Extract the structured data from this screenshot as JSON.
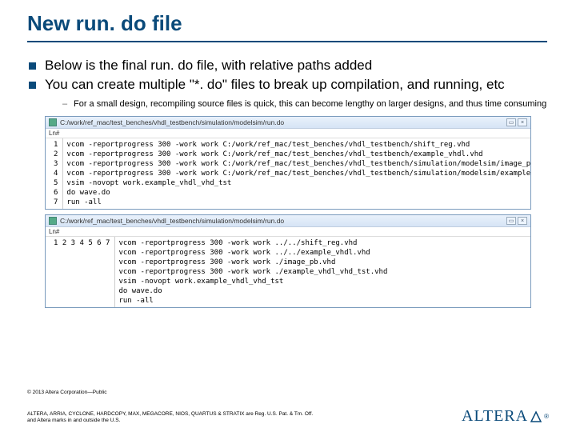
{
  "title": "New run. do file",
  "bullets": [
    "Below is the final run. do file, with relative paths added",
    "You can create multiple \"*. do\" files to break up compilation, and running, etc"
  ],
  "sub_bullet": "For a small design, recompiling source files is quick, this can become lengthy on larger designs, and thus time consuming",
  "editor1": {
    "path": "C:/work/ref_mac/test_benches/vhdl_testbench/simulation/modelsim/run.do",
    "ln": "Ln#",
    "lines": [
      "vcom -reportprogress 300 -work work C:/work/ref_mac/test_benches/vhdl_testbench/shift_reg.vhd",
      "vcom -reportprogress 300 -work work C:/work/ref_mac/test_benches/vhdl_testbench/example_vhdl.vhd",
      "vcom -reportprogress 300 -work work C:/work/ref_mac/test_benches/vhdl_testbench/simulation/modelsim/image_pb.vhd",
      "vcom -reportprogress 300 -work work C:/work/ref_mac/test_benches/vhdl_testbench/simulation/modelsim/example_vhdl",
      "vsim -novopt work.example_vhdl_vhd_tst",
      "do wave.do",
      "run -all"
    ]
  },
  "editor2": {
    "path": "C:/work/ref_mac/test_benches/vhdl_testbench/simulation/modelsim/run.do",
    "ln": "Ln#",
    "lines": [
      "vcom -reportprogress 300 -work work ../../shift_reg.vhd",
      "vcom -reportprogress 300 -work work ../../example_vhdl.vhd",
      "vcom -reportprogress 300 -work work ./image_pb.vhd",
      "vcom -reportprogress 300 -work work ./example_vhdl_vhd_tst.vhd",
      "vsim -novopt work.example_vhdl_vhd_tst",
      "do wave.do",
      "run -all"
    ]
  },
  "copyright": "© 2013 Altera Corporation—Public",
  "footer1": "ALTERA, ARRIA, CYCLONE, HARDCOPY, MAX, MEGACORE, NIOS, QUARTUS & STRATIX are Reg. U.S. Pat. & Tm. Off.",
  "footer2": "and Altera marks in and outside the U.S.",
  "logo": "ALTERA"
}
